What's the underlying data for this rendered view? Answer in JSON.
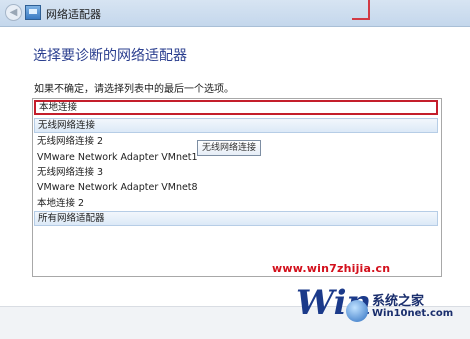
{
  "window": {
    "title": "网络适配器"
  },
  "heading": "选择要诊断的网络适配器",
  "hint": "如果不确定，请选择列表中的最后一个选项。",
  "adapters": [
    "本地连接",
    "无线网络连接",
    "无线网络连接 2",
    "VMware Network Adapter VMnet1",
    "无线网络连接 3",
    "VMware Network Adapter VMnet8",
    "本地连接 2",
    "所有网络适配器"
  ],
  "tooltip": "无线网络连接",
  "watermark": {
    "url": "www.win7zhijia.cn",
    "logo_text": "Win7",
    "name": "系统之家",
    "site": "Win10net.com"
  },
  "colors": {
    "selection_border": "#c41e2b",
    "heading": "#2b3f8f",
    "watermark_red": "#d3101c"
  },
  "icons": {
    "back": "back-arrow-icon",
    "title": "network-adapter-icon"
  }
}
